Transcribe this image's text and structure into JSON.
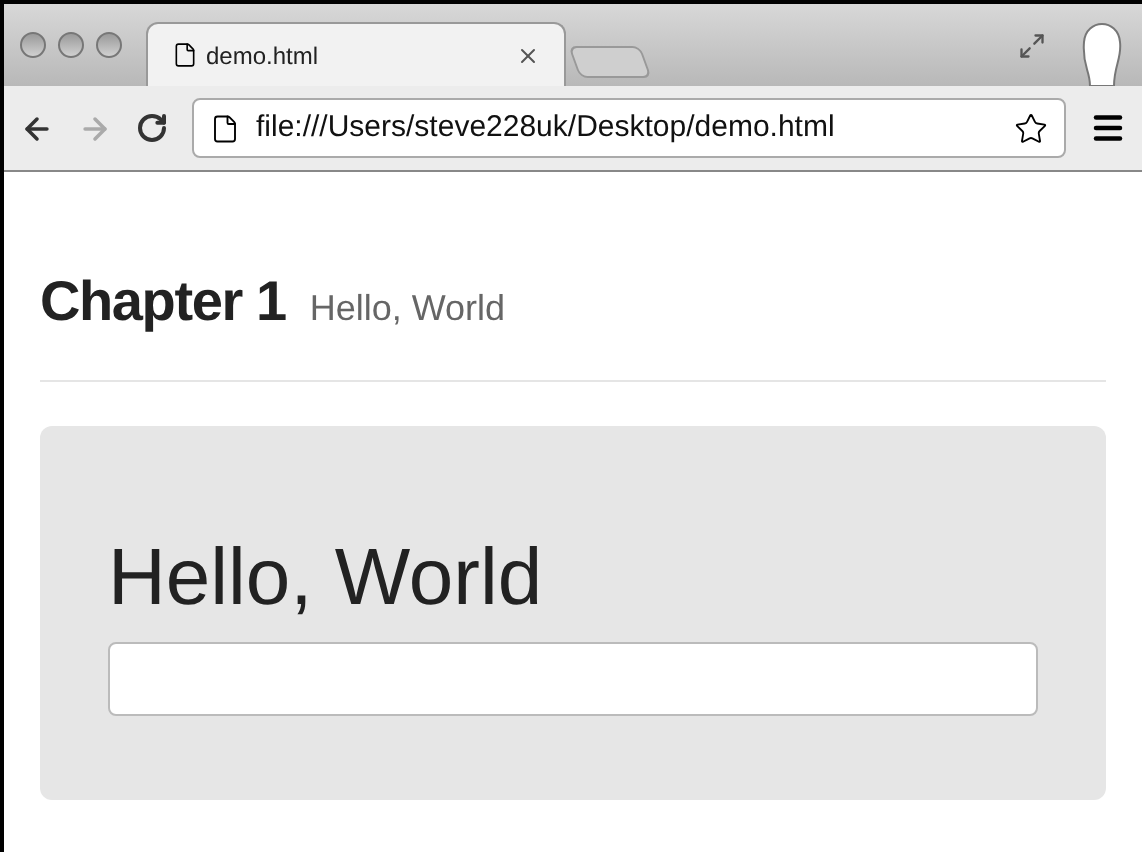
{
  "tabs": [
    {
      "title": "demo.html",
      "selected": true
    }
  ],
  "toolbar": {
    "address": "file:///Users/steve228uk/Desktop/demo.html",
    "forward_disabled": true
  },
  "page": {
    "heading": "Chapter 1",
    "subheading": "Hello, World",
    "jumbotron": {
      "title": "Hello, World"
    }
  }
}
